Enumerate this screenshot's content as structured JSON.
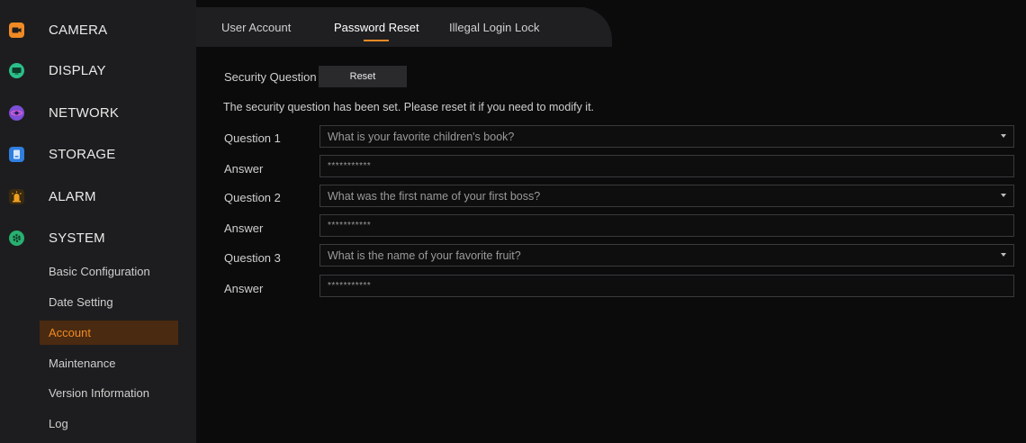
{
  "sidebar": {
    "menu": [
      {
        "label": "CAMERA",
        "icon": "camera-icon",
        "color": "#f08a24"
      },
      {
        "label": "DISPLAY",
        "icon": "display-icon",
        "color": "#2bbf8a"
      },
      {
        "label": "NETWORK",
        "icon": "network-icon",
        "color": "#7b4fd6"
      },
      {
        "label": "STORAGE",
        "icon": "storage-icon",
        "color": "#2f7fe0"
      },
      {
        "label": "ALARM",
        "icon": "alarm-icon",
        "color": "#f0a020"
      },
      {
        "label": "SYSTEM",
        "icon": "system-gear-icon",
        "color": "#28b070"
      }
    ],
    "system_submenu": [
      {
        "label": "Basic Configuration"
      },
      {
        "label": "Date Setting"
      },
      {
        "label": "Account",
        "active": true
      },
      {
        "label": "Maintenance"
      },
      {
        "label": "Version Information"
      },
      {
        "label": "Log"
      }
    ]
  },
  "tabs": [
    {
      "label": "User Account"
    },
    {
      "label": "Password Reset",
      "active": true
    },
    {
      "label": "Illegal Login Lock"
    }
  ],
  "form": {
    "security_question_label": "Security Question",
    "reset_button": "Reset",
    "notice": "The security question has been set. Please reset it if you need to modify it.",
    "questions": [
      {
        "label": "Question 1",
        "value": "What is your favorite children's book?",
        "answer_label": "Answer",
        "answer_value": "***********"
      },
      {
        "label": "Question 2",
        "value": "What was the first name of your first boss?",
        "answer_label": "Answer",
        "answer_value": "***********"
      },
      {
        "label": "Question 3",
        "value": "What is the name of your favorite fruit?",
        "answer_label": "Answer",
        "answer_value": "***********"
      }
    ]
  },
  "colors": {
    "accent": "#f08a24",
    "active_bg": "#4a2a10"
  }
}
